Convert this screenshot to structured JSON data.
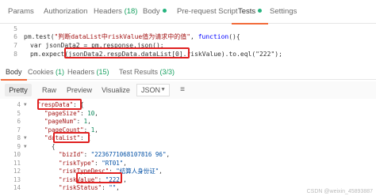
{
  "request_tabs": [
    {
      "label": "Params",
      "count": "",
      "dot": false,
      "active": false
    },
    {
      "label": "Authorization",
      "count": "",
      "dot": false,
      "active": false
    },
    {
      "label": "Headers",
      "count": "(18)",
      "dot": false,
      "active": false
    },
    {
      "label": "Body",
      "count": "",
      "dot": true,
      "active": false
    },
    {
      "label": "Pre-request Script",
      "count": "",
      "dot": false,
      "active": false
    },
    {
      "label": "Tests",
      "count": "",
      "dot": true,
      "active": true
    },
    {
      "label": "Settings",
      "count": "",
      "dot": false,
      "active": false
    }
  ],
  "editor": {
    "line_numbers": [
      "5",
      "6",
      "7",
      "8"
    ],
    "line6_a": "pm.test(",
    "line6_str": "\"判断dataList中riskValue值为请求中的值\"",
    "line6_b": ", ",
    "line6_kw": "function",
    "line6_c": "(){",
    "line7": "var jsonData2 = pm.response.json();",
    "line8_a": "pm.expect(",
    "line8_b": "jsonData2.respData.dataList[0].riskValue",
    "line8_c": ").to.eql(\"222\");"
  },
  "response_tabs": [
    {
      "label": "Body",
      "count": "",
      "active": true
    },
    {
      "label": "Cookies",
      "count": "(1)",
      "active": false
    },
    {
      "label": "Headers",
      "count": "(15)",
      "active": false
    },
    {
      "label": "Test Results",
      "count": "(3/3)",
      "active": false
    }
  ],
  "view_bar": {
    "pretty": "Pretty",
    "raw": "Raw",
    "preview": "Preview",
    "visualize": "Visualize",
    "format": "JSON",
    "wrap_icon": "wrap-lines-icon"
  },
  "json_lines": [
    {
      "n": "4",
      "key": "\"respData\"",
      "punct": ": {",
      "indent": 1,
      "fold": true
    },
    {
      "n": "5",
      "key": "\"pageSize\"",
      "punct": ": ",
      "num": "10",
      "tail": ",",
      "indent": 2
    },
    {
      "n": "6",
      "key": "\"pageNum\"",
      "punct": ": ",
      "num": "1",
      "tail": ",",
      "indent": 2
    },
    {
      "n": "7",
      "key": "\"pageCount\"",
      "punct": ": ",
      "num": "1",
      "tail": ",",
      "indent": 2
    },
    {
      "n": "8",
      "key": "\"dataList\"",
      "punct": ": [",
      "indent": 2,
      "fold": true
    },
    {
      "n": "9",
      "key": "",
      "punct": "{",
      "indent": 3,
      "fold": true
    },
    {
      "n": "10",
      "key": "\"bizId\"",
      "punct": ": ",
      "str": "\"2236771068107816 96\"",
      "tail": ",",
      "indent": 4
    },
    {
      "n": "11",
      "key": "\"riskType\"",
      "punct": ": ",
      "str": "\"RT01\"",
      "tail": ",",
      "indent": 4
    },
    {
      "n": "12",
      "key": "\"riskTypeDesc\"",
      "punct": ": ",
      "str": "\"结算人身份证\"",
      "tail": ",",
      "indent": 4
    },
    {
      "n": "13",
      "key": "\"riskValue\"",
      "punct": ": ",
      "str": "\"222\"",
      "tail": ",",
      "indent": 4
    },
    {
      "n": "14",
      "key": "\"riskStatus\"",
      "punct": ": ",
      "str": "\"\"",
      "tail": ",",
      "indent": 4
    }
  ],
  "watermark": "CSDN @weixin_45893887"
}
